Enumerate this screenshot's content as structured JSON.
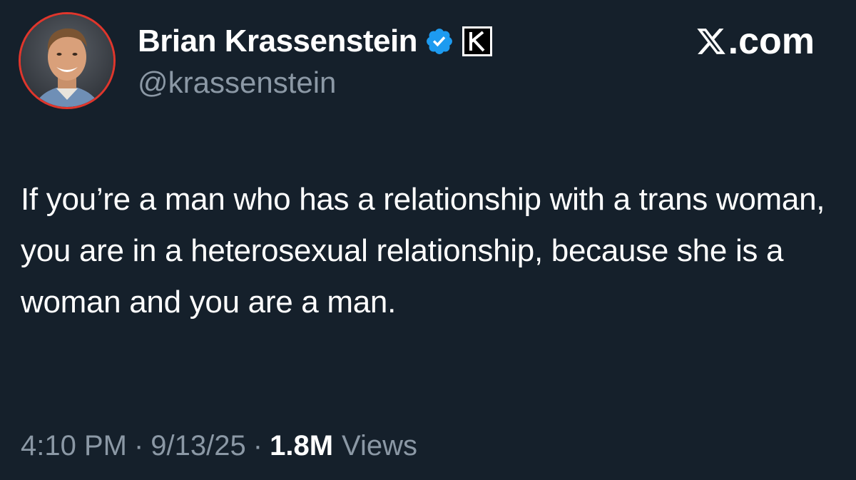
{
  "author": {
    "display_name": "Brian Krassenstein",
    "handle": "@krassenstein",
    "verified_icon": "verified-badge-icon",
    "affiliate_badge_letter": "K"
  },
  "brand": {
    "logo_icon": "x-logo-icon",
    "suffix": ".com"
  },
  "tweet": {
    "text": "If you’re a man who has a relationship with a trans woman, you are in a heterosexual relationship, because she is a woman and you are a man.",
    "time": "4:10 PM",
    "date": "9/13/25",
    "separator": "·",
    "views_count": "1.8M",
    "views_label": "Views"
  },
  "colors": {
    "background": "#15202b",
    "text_primary": "#ffffff",
    "text_secondary": "#8b98a5",
    "verified_blue": "#1d9bf0",
    "avatar_ring": "#e0362c"
  }
}
